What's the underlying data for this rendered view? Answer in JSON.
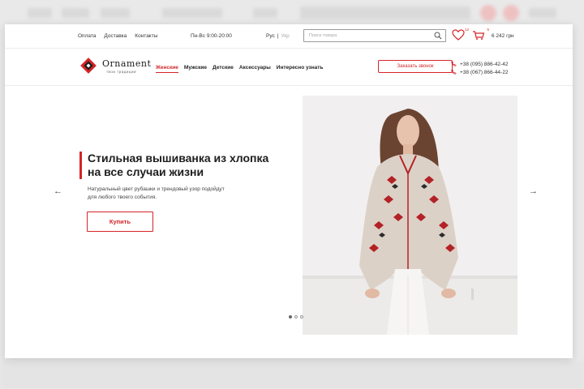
{
  "topbar": {
    "links": [
      "Оплата",
      "Доставка",
      "Контакты"
    ],
    "hours": "Пн-Вс 9:00-20:00",
    "lang_active": "Рус",
    "lang_separator": "|",
    "lang_other": "Укр",
    "search_placeholder": "Поиск товара",
    "wishlist_count": "12",
    "cart_count": "5",
    "cart_total": "6 242 грн"
  },
  "logo": {
    "name": "Ornament",
    "tagline": "твои традиции"
  },
  "nav": {
    "items": [
      "Женские",
      "Мужские",
      "Детские",
      "Аксессуары",
      "Интересно узнать"
    ],
    "active_index": 0
  },
  "callback_label": "Заказать звонок",
  "phones": [
    "+38 (095) 886-42-42",
    "+38 (067) 866-44-22"
  ],
  "hero": {
    "title_line1": "Стильная вышиванка из хлопка",
    "title_line2": "на все случаи жизни",
    "description": "Натуральный цвет рубашки и трендовый узор подойдут для любого твоего события.",
    "button": "Купить",
    "prev_arrow": "←",
    "next_arrow": "→",
    "slides_total": 3,
    "slide_active": 1
  },
  "colors": {
    "accent": "#d42428",
    "text": "#222222",
    "page_bg": "#ffffff",
    "backdrop": "#e9e9e9"
  },
  "icons": [
    "search-icon",
    "heart-icon",
    "cart-icon",
    "phone-icon",
    "arrow-left-icon",
    "arrow-right-icon"
  ]
}
